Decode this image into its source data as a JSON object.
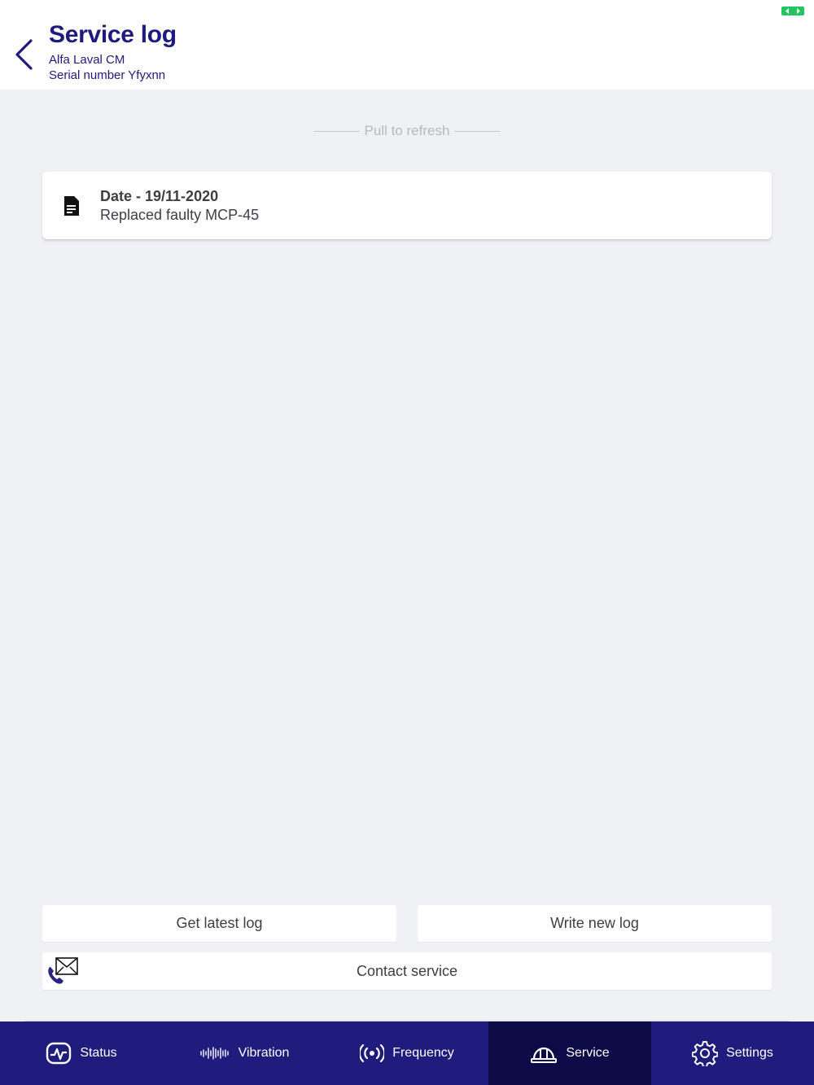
{
  "header": {
    "title": "Service log",
    "device_name": "Alfa Laval CM",
    "serial": "Serial number Yfyxnn"
  },
  "status_bar": {
    "battery_icon": "battery-charging-icon",
    "battery_color": "#22c55e"
  },
  "refresh_hint": "Pull to refresh",
  "logs": [
    {
      "date": "Date - 19/11-2020",
      "description": "Replaced faulty MCP-45",
      "icon": "document-icon"
    }
  ],
  "actions": {
    "get_latest": "Get latest log",
    "write_new": "Write new log",
    "contact": "Contact service"
  },
  "tabs": [
    {
      "label": "Status",
      "icon": "status-monitor-icon",
      "active": false
    },
    {
      "label": "Vibration",
      "icon": "waveform-icon",
      "active": false
    },
    {
      "label": "Frequency",
      "icon": "broadcast-icon",
      "active": false
    },
    {
      "label": "Service",
      "icon": "hard-hat-icon",
      "active": true
    },
    {
      "label": "Settings",
      "icon": "gear-icon",
      "active": false
    }
  ],
  "colors": {
    "accent": "#1f1a80",
    "tabbar_bg": "#201c7e",
    "tab_active_bg": "#0d0b47",
    "page_bg": "#f0f1f5"
  }
}
